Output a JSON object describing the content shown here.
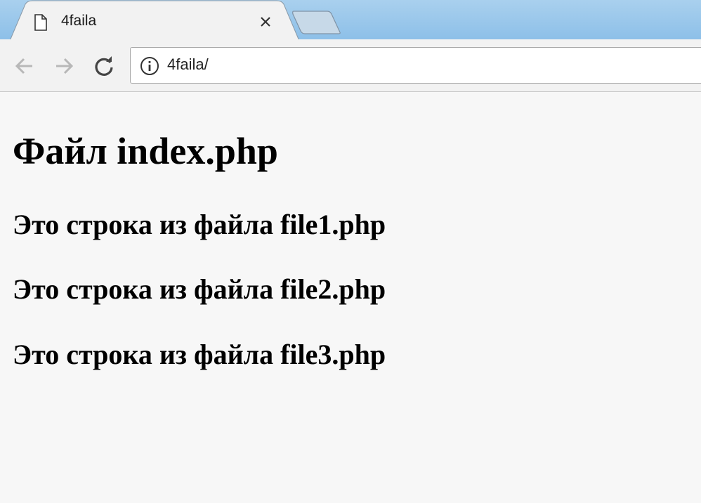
{
  "tab": {
    "title": "4faila",
    "favicon": "page-icon",
    "close": "close-icon"
  },
  "toolbar": {
    "back": "arrow-left-icon",
    "forward": "arrow-right-icon",
    "reload": "reload-icon",
    "url": "4faila/",
    "site_info": "info-icon"
  },
  "page": {
    "heading": "Файл index.php",
    "lines": [
      "Это строка из файла file1.php",
      "Это строка из файла file2.php",
      "Это строка из файла file3.php"
    ]
  },
  "colors": {
    "tabstrip": "#9ccaec",
    "toolbar": "#f2f2f2",
    "page_background": "#f7f7f7",
    "text": "#000000"
  }
}
